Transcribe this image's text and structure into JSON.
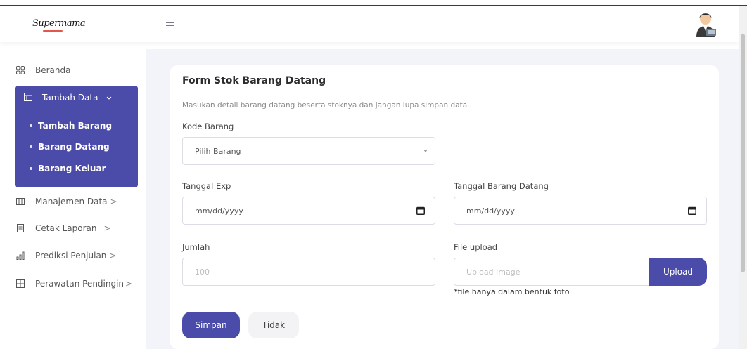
{
  "brand": {
    "logo_text": "Supermama"
  },
  "header": {
    "menu_icon": "hamburger-icon",
    "avatar_icon": "user-avatar-icon"
  },
  "sidebar": {
    "beranda": "Beranda",
    "tambah_data": {
      "label": "Tambah Data",
      "items": [
        "Tambah Barang",
        "Barang Datang",
        "Barang Keluar"
      ]
    },
    "manajemen_data": "Manajemen Data",
    "cetak_laporan": "Cetak Laporan",
    "prediksi_penjualan": "Prediksi Penjulan",
    "perawatan_pendingin": "Perawatan Pendingin",
    "arrow": ">"
  },
  "form": {
    "title": "Form Stok Barang Datang",
    "description": "Masukan detail barang datang beserta stoknya dan jangan lupa simpan data.",
    "kode_barang_label": "Kode Barang",
    "kode_barang_value": "Pilih Barang",
    "tanggal_exp_label": "Tanggal Exp",
    "tanggal_exp_value": "mm/dd/yyyy",
    "tanggal_datang_label": "Tanggal Barang Datang",
    "tanggal_datang_value": "mm/dd/yyyy",
    "jumlah_label": "Jumlah",
    "jumlah_placeholder": "100",
    "file_label": "File upload",
    "file_placeholder": "Upload Image",
    "upload_button": "Upload",
    "file_hint": "*file hanya dalam bentuk foto",
    "save_button": "Simpan",
    "cancel_button": "Tidak"
  },
  "colors": {
    "accent": "#4b4baa",
    "logo_underline": "#e4564a",
    "background": "#f3f4f9"
  }
}
